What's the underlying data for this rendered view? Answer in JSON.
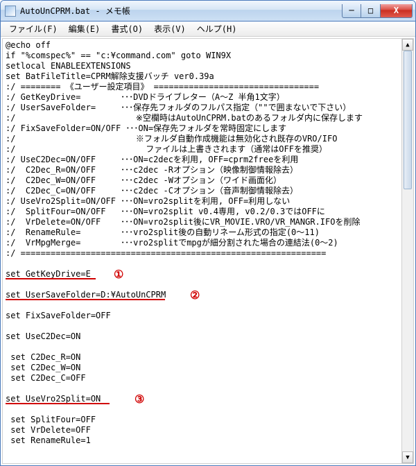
{
  "window": {
    "title": "AutoUnCPRM.bat - メモ帳"
  },
  "menu": {
    "file": "ファイル(F)",
    "edit": "編集(E)",
    "format": "書式(O)",
    "view": "表示(V)",
    "help": "ヘルプ(H)"
  },
  "buttons": {
    "min": "─",
    "max": "□",
    "close": "X"
  },
  "annotations": {
    "n1": "①",
    "n2": "②",
    "n3": "③"
  },
  "lines": {
    "l01": "@echo off",
    "l02": "if \"%comspec%\" == \"c:¥command.com\" goto WIN9X",
    "l03": "setlocal ENABLEEXTENSIONS",
    "l04": "set BatFileTitle=CPRM解除支援バッチ ver0.39a",
    "l05": ":/ ======== 《ユーザー設定項目》 =================================",
    "l06": ":/ GetKeyDrive=        ･･･DVDドライブレター（A～Z 半角1文字）",
    "l07": ":/ UserSaveFolder=     ･･･保存先フォルダのフルパス指定（\"\"で囲まないで下さい）",
    "l08": ":/                        ※空欄時はAutoUnCPRM.batのあるフォルダ内に保存します",
    "l09": ":/ FixSaveFolder=ON/OFF ･･･ON=保存先フォルダを常時固定にします",
    "l10": ":/                        ※フォルダ自動作成機能は無効化され既存のVRO/IFO",
    "l11": ":/                          ファイルは上書きされます（通常はOFFを推奨）",
    "l12": ":/ UseC2Dec=ON/OFF     ･･･ON=c2decを利用, OFF=cprm2freeを利用",
    "l13": ":/  C2Dec_R=ON/OFF     ･･･c2dec -Rオプション（映像制御情報除去）",
    "l14": ":/  C2Dec_W=ON/OFF     ･･･c2dec -Wオプション（ワイド画面化）",
    "l15": ":/  C2Dec_C=ON/OFF     ･･･c2dec -Cオプション（音声制御情報除去）",
    "l16": ":/ UseVro2Split=ON/OFF ･･･ON=vro2splitを利用, OFF=利用しない",
    "l17": ":/  SplitFour=ON/OFF   ･･･ON=vro2split v0.4専用, v0.2/0.3ではOFFに",
    "l18": ":/  VrDelete=ON/OFF    ･･･ON=vro2split後にVR_MOVIE.VRO/VR_MANGR.IFOを削除",
    "l19": ":/  RenameRule=        ･･･vro2split後の自動リネーム形式の指定(0～11)",
    "l20": ":/  VrMpgMerge=        ･･･vro2splitでmpgが細分割された場合の連結法(0～2)",
    "l21": ":/ =============================================================",
    "l22": "",
    "l23": "set GetKeyDrive=E",
    "l24": "",
    "l25": "set UserSaveFolder=D:¥AutoUnCPRM",
    "l26": "",
    "l27": "set FixSaveFolder=OFF",
    "l28": "",
    "l29": "set UseC2Dec=ON",
    "l30": "",
    "l31": " set C2Dec_R=ON",
    "l32": " set C2Dec_W=ON",
    "l33": " set C2Dec_C=OFF",
    "l34": "",
    "l35": "set UseVro2Split=ON",
    "l36": "",
    "l37": " set SplitFour=OFF",
    "l38": " set VrDelete=OFF",
    "l39": " set RenameRule=1",
    "l40": ""
  }
}
